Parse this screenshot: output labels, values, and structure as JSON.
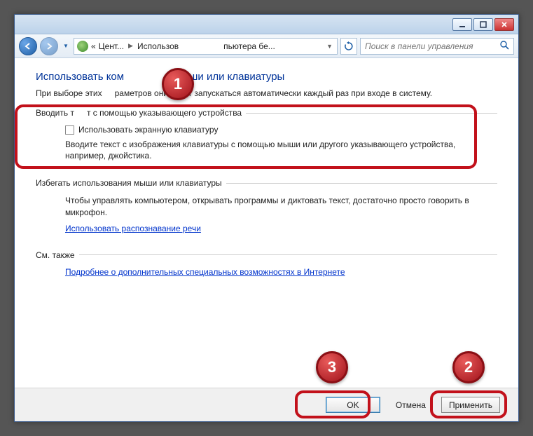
{
  "titlebar": {
    "minimize_icon": "minimize-icon",
    "maximize_icon": "maximize-icon",
    "close_icon": "close-icon"
  },
  "nav": {
    "breadcrumb_prefix": "«",
    "breadcrumb_seg1": "Цент...",
    "breadcrumb_seg2": "Использов",
    "breadcrumb_seg3": "пьютера бе...",
    "search_placeholder": "Поиск в панели управления"
  },
  "page": {
    "title_prefix": "Использовать ком",
    "title_suffix": "ыши или клавиатуры",
    "subtitle_prefix": "При выборе этих",
    "subtitle_suffix": "раметров они будут запускаться автоматически каждый раз при входе в систему."
  },
  "group1": {
    "label_prefix": "Вводить т",
    "label_suffix": "т с помощью указывающего устройства",
    "checkbox_label": "Использовать экранную клавиатуру",
    "description": "Вводите текст с изображения клавиатуры с помощью мыши или другого указывающего устройства, например, джойстика."
  },
  "group2": {
    "label": "Избегать использования мыши или клавиатуры",
    "description": "Чтобы управлять компьютером, открывать программы и диктовать текст, достаточно просто говорить в микрофон.",
    "link": "Использовать распознавание речи"
  },
  "group3": {
    "label": "См. также",
    "link": "Подробнее о дополнительных специальных возможностях в Интернете"
  },
  "footer": {
    "ok": "OK",
    "cancel": "Отмена",
    "apply": "Применить"
  },
  "annotations": {
    "b1": "1",
    "b2": "2",
    "b3": "3"
  }
}
